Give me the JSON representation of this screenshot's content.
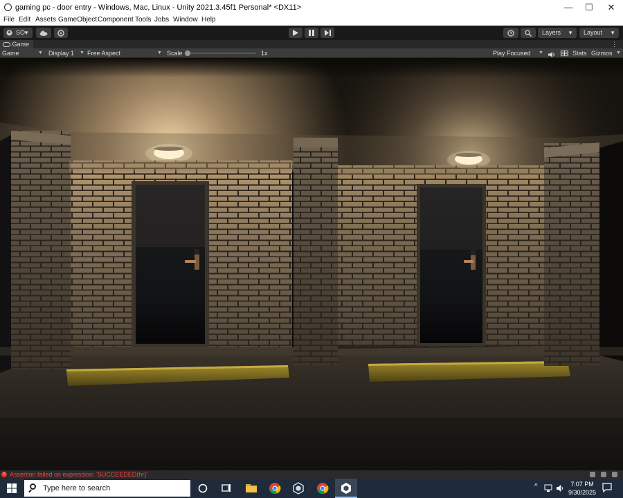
{
  "window": {
    "title": "gaming pc - door entry - Windows, Mac, Linux - Unity 2021.3.45f1 Personal* <DX11>",
    "minimize_label": "—",
    "maximize_label": "☐",
    "close_label": "✕"
  },
  "menu": [
    "File",
    "Edit",
    "Assets",
    "GameObject",
    "Component",
    "Tools",
    "Jobs",
    "Window",
    "Help"
  ],
  "toolbar": {
    "account_label": "SO",
    "layers_label": "Layers",
    "layout_label": "Layout"
  },
  "game_tab": {
    "label": "Game",
    "more_label": "⋮"
  },
  "game_bar": {
    "view_mode": "Game",
    "display": "Display 1",
    "aspect": "Free Aspect",
    "scale_label": "Scale",
    "scale_value": "1x",
    "play_mode": "Play Focused",
    "stats_label": "Stats",
    "gizmos_label": "Gizmos"
  },
  "console": {
    "message": "Assertion failed on expression: 'SUCCEEDED(hr)'"
  },
  "taskbar": {
    "search_placeholder": "Type here to search",
    "time": "7:07 PM",
    "date": "9/30/2025"
  },
  "icons": [
    "unity-icon",
    "cloud-icon",
    "settings-icon",
    "play-icon",
    "pause-icon",
    "step-icon",
    "history-icon",
    "search-icon",
    "game-controller-icon",
    "speaker-icon",
    "stats-grid-icon",
    "windows-start-icon",
    "task-view-icon",
    "file-explorer-icon",
    "chrome-icon",
    "unity-hub-icon",
    "chrome-icon",
    "unity-editor-icon",
    "notification-icon"
  ]
}
